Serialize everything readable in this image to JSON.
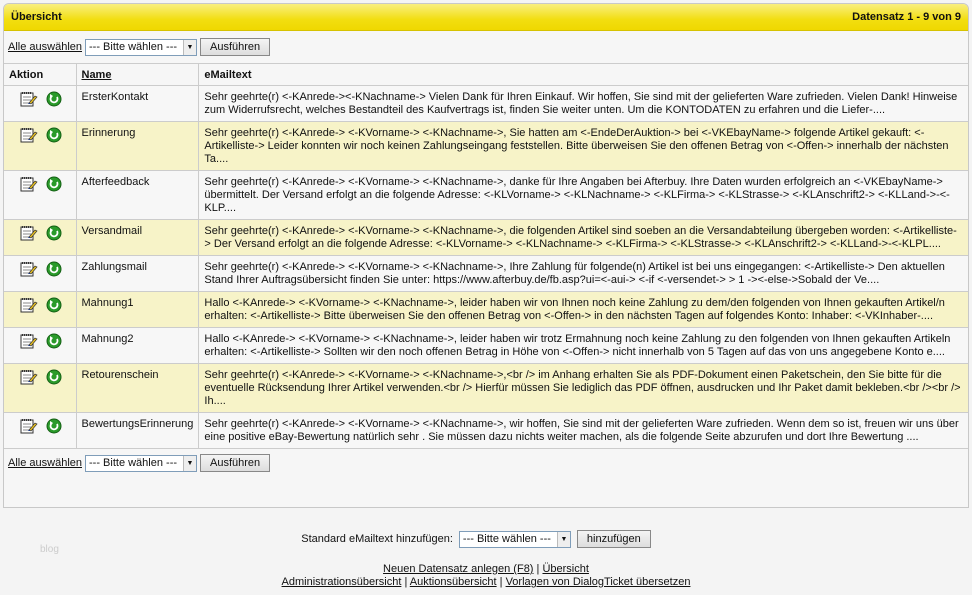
{
  "header": {
    "title": "Übersicht",
    "record_info": "Datensatz 1 - 9 von 9"
  },
  "toolbar": {
    "select_all": "Alle auswählen",
    "select_placeholder": "--- Bitte wählen ---",
    "execute": "Ausführen"
  },
  "table": {
    "columns": [
      "Aktion",
      "Name",
      "eMailtext"
    ],
    "rows": [
      {
        "name": "ErsterKontakt",
        "text": "Sehr geehrte(r) <-KAnrede-><-KNachname-> Vielen Dank für Ihren Einkauf. Wir hoffen, Sie sind mit der gelieferten Ware zufrieden. Vielen Dank! Hinweise zum Widerrufsrecht, welches Bestandteil des Kaufvertrags ist, finden Sie weiter unten. Um die KONTODATEN zu erfahren und die Liefer-...."
      },
      {
        "name": "Erinnerung",
        "text": "Sehr geehrte(r) <-KAnrede-> <-KVorname-> <-KNachname->, Sie hatten am <-EndeDerAuktion-> bei <-VKEbayName-> folgende Artikel gekauft: <-Artikelliste-> Leider konnten wir noch keinen Zahlungseingang feststellen. Bitte überweisen Sie den offenen Betrag von <-Offen-> innerhalb der nächsten Ta...."
      },
      {
        "name": "Afterfeedback",
        "text": "Sehr geehrte(r) <-KAnrede-> <-KVorname-> <-KNachname->, danke für Ihre Angaben bei Afterbuy. Ihre Daten wurden erfolgreich an <-VKEbayName-> übermittelt. Der Versand erfolgt an die folgende Adresse: <-KLVorname-> <-KLNachname-> <-KLFirma-> <-KLStrasse-> <-KLAnschrift2-> <-KLLand->-<-KLP...."
      },
      {
        "name": "Versandmail",
        "text": "Sehr geehrte(r) <-KAnrede-> <-KVorname-> <-KNachname->, die folgenden Artikel sind soeben an die Versandabteilung übergeben worden: <-Artikelliste-> Der Versand erfolgt an die folgende Adresse: <-KLVorname-> <-KLNachname-> <-KLFirma-> <-KLStrasse-> <-KLAnschrift2-> <-KLLand->-<-KLPL...."
      },
      {
        "name": "Zahlungsmail",
        "text": "Sehr geehrte(r) <-KAnrede-> <-KVorname-> <-KNachname->, Ihre Zahlung für folgende(n) Artikel ist bei uns eingegangen: <-Artikelliste-> Den aktuellen Stand Ihrer Auftragsübersicht finden Sie unter: https://www.afterbuy.de/fb.asp?ui=<-aui-> <-if <-versendet-> > 1 -><-else->Sobald der Ve...."
      },
      {
        "name": "Mahnung1",
        "text": "Hallo <-KAnrede-> <-KVorname-> <-KNachname->, leider haben wir von Ihnen noch keine Zahlung zu dem/den folgenden von Ihnen gekauften Artikel/n erhalten: <-Artikelliste-> Bitte überweisen Sie den offenen Betrag von <-Offen-> in den nächsten Tagen auf folgendes Konto: Inhaber: <-VKInhaber-...."
      },
      {
        "name": "Mahnung2",
        "text": "Hallo <-KAnrede-> <-KVorname-> <-KNachname->, leider haben wir trotz Ermahnung noch keine Zahlung zu den folgenden von Ihnen gekauften Artikeln erhalten: <-Artikelliste-> Sollten wir den noch offenen Betrag in Höhe von <-Offen-> nicht innerhalb von 5 Tagen auf das von uns angegebene Konto e...."
      },
      {
        "name": "Retourenschein",
        "text": "Sehr geehrte(r) <-KAnrede-> <-KVorname-> <-KNachname->,<br /> im Anhang erhalten Sie als PDF-Dokument einen Paketschein, den Sie bitte für die eventuelle Rücksendung Ihrer Artikel verwenden.<br /> Hierfür müssen Sie lediglich das PDF öffnen, ausdrucken und Ihr Paket damit bekleben.<br /><br /> Ih...."
      },
      {
        "name": "BewertungsErinnerung",
        "text": "Sehr geehrte(r) <-KAnrede-> <-KVorname-> <-KNachname->, wir hoffen, Sie sind mit der gelieferten Ware zufrieden. Wenn dem so ist, freuen wir uns über eine positive eBay-Bewertung natürlich sehr . Sie müssen dazu nichts weiter machen, als die folgende Seite abzurufen und dort Ihre Bewertung ...."
      }
    ]
  },
  "footer": {
    "std_label": "Standard eMailtext hinzufügen:",
    "std_select": "--- Bitte wählen ---",
    "add": "hinzufügen",
    "blog": "blog",
    "links": [
      "Neuen Datensatz anlegen (F8)",
      "Übersicht",
      "Administrationsübersicht",
      "Auktionsübersicht",
      "Vorlagen von DialogTicket übersetzen"
    ]
  }
}
